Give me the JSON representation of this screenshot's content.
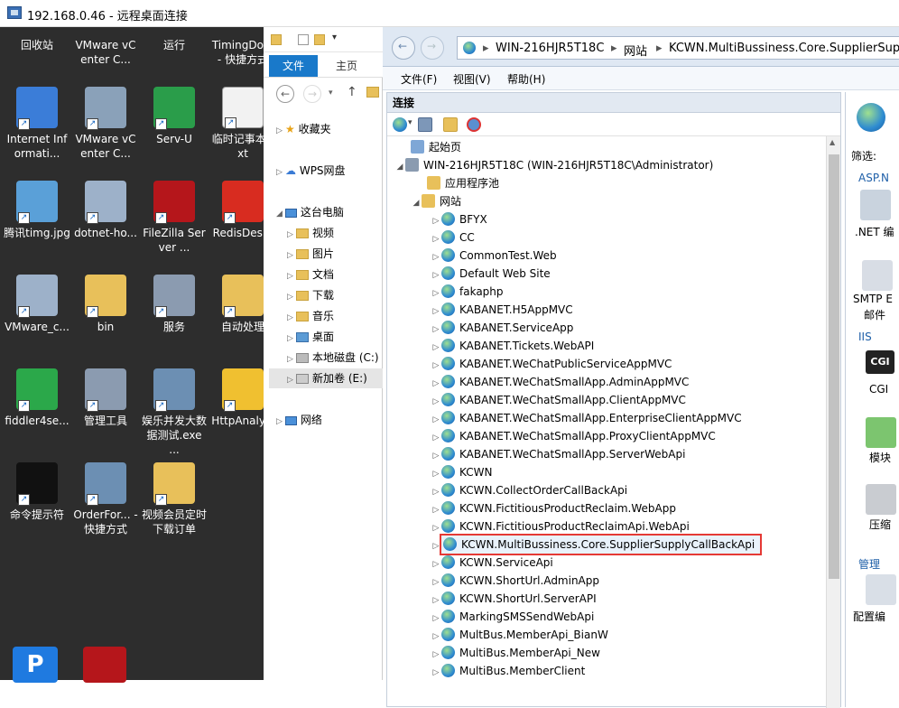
{
  "rdp": {
    "title": "192.168.0.46 - 远程桌面连接"
  },
  "desktop": {
    "top_labels": [
      "回收站",
      "VMware vCenter C...",
      "运行",
      "TimingDo... - 快捷方式"
    ],
    "icons": [
      {
        "label": "Internet Informati...",
        "icon": "iis-icon"
      },
      {
        "label": "VMware vCenter C...",
        "icon": "vmware-icon"
      },
      {
        "label": "Serv-U",
        "icon": "servu-icon"
      },
      {
        "label": "临时记事本.txt",
        "icon": "text-file-icon"
      },
      {
        "label": "腾讯timg.jpg",
        "icon": "image-file-icon"
      },
      {
        "label": "dotnet-ho...",
        "icon": "installer-icon"
      },
      {
        "label": "FileZilla Server ...",
        "icon": "filezilla-icon"
      },
      {
        "label": "RedisDes...",
        "icon": "redis-icon"
      },
      {
        "label": "VMware_c...",
        "icon": "installer-icon"
      },
      {
        "label": "bin",
        "icon": "folder-icon"
      },
      {
        "label": "服务",
        "icon": "services-icon"
      },
      {
        "label": "自动处理",
        "icon": "folder-icon"
      },
      {
        "label": "fiddler4se...",
        "icon": "fiddler-icon"
      },
      {
        "label": "管理工具",
        "icon": "admin-tools-icon"
      },
      {
        "label": "娱乐并发大数据测试.exe ...",
        "icon": "app-icon"
      },
      {
        "label": "HttpAnaly...",
        "icon": "httpanalyzer-icon"
      },
      {
        "label": "命令提示符",
        "icon": "cmd-icon"
      },
      {
        "label": "OrderFor... - 快捷方式",
        "icon": "app-icon"
      },
      {
        "label": "视频会员定时下载订单",
        "icon": "folder-icon"
      }
    ]
  },
  "explorer": {
    "tabs": {
      "file": "文件",
      "home": "主页"
    },
    "tree": {
      "favorites": "收藏夹",
      "wps": "WPS网盘",
      "this_pc": "这台电脑",
      "videos": "视频",
      "pictures": "图片",
      "documents": "文档",
      "downloads": "下载",
      "music": "音乐",
      "desktop": "桌面",
      "local_disk": "本地磁盘 (C:)",
      "new_volume": "新加卷 (E:)",
      "network": "网络"
    }
  },
  "iis": {
    "breadcrumb": [
      "WIN-216HJR5T18C",
      "网站",
      "KCWN.MultiBussiness.Core.SupplierSupplyC"
    ],
    "menu": {
      "file": "文件(F)",
      "view": "视图(V)",
      "help": "帮助(H)"
    },
    "connections_header": "连接",
    "tree": {
      "start_page": "起始页",
      "server": "WIN-216HJR5T18C (WIN-216HJR5T18C\\Administrator)",
      "app_pools": "应用程序池",
      "sites_label": "网站",
      "sites": [
        "BFYX",
        "CC",
        "CommonTest.Web",
        "Default Web Site",
        "fakaphp",
        "KABANET.H5AppMVC",
        "KABANET.ServiceApp",
        "KABANET.Tickets.WebAPI",
        "KABANET.WeChatPublicServiceAppMVC",
        "KABANET.WeChatSmallApp.AdminAppMVC",
        "KABANET.WeChatSmallApp.ClientAppMVC",
        "KABANET.WeChatSmallApp.EnterpriseClientAppMVC",
        "KABANET.WeChatSmallApp.ProxyClientAppMVC",
        "KABANET.WeChatSmallApp.ServerWebApi",
        "KCWN",
        "KCWN.CollectOrderCallBackApi",
        "KCWN.FictitiousProductReclaim.WebApp",
        "KCWN.FictitiousProductReclaimApi.WebApi",
        "KCWN.MultiBussiness.Core.SupplierSupplyCallBackApi",
        "KCWN.ServiceApi",
        "KCWN.ShortUrl.AdminApp",
        "KCWN.ShortUrl.ServerAPI",
        "MarkingSMSSendWebApi",
        "MultBus.MemberApi_BianW",
        "MultiBus.MemberApi_New",
        "MultiBus.MemberClient"
      ],
      "selected_index": 18
    },
    "right": {
      "filter": "筛选:",
      "asp": "ASP.N",
      "net": ".NET 编",
      "smtp": "SMTP E",
      "mail": "邮件",
      "iis": "IIS",
      "cgi_icon": "CGI",
      "cgi": "CGI",
      "modules": "模块",
      "compress": "压缩",
      "manage": "管理",
      "config": "配置编"
    }
  }
}
